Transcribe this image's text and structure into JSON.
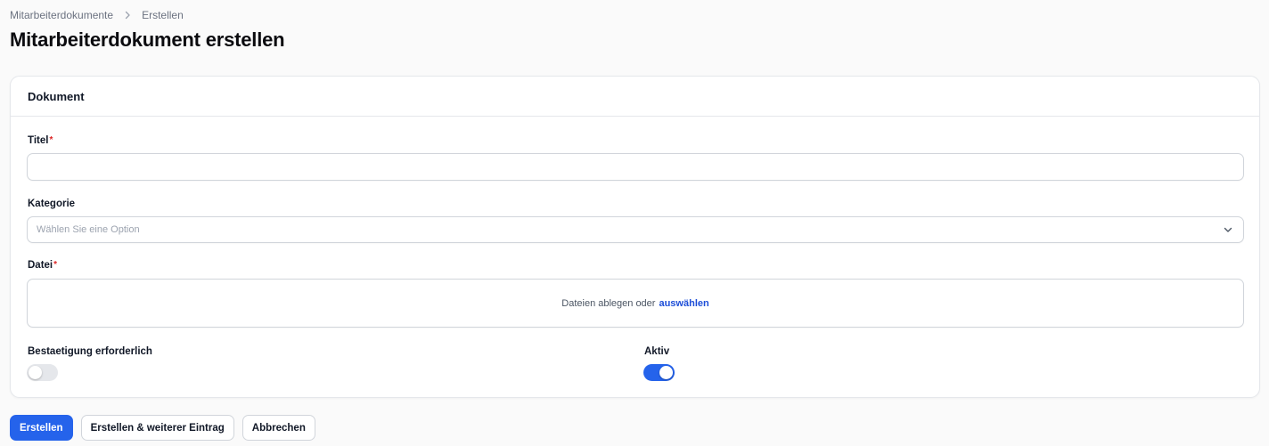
{
  "breadcrumb": {
    "items": [
      "Mitarbeiterdokumente",
      "Erstellen"
    ]
  },
  "page_title": "Mitarbeiterdokument erstellen",
  "section": {
    "title": "Dokument"
  },
  "fields": {
    "titel": {
      "label": "Titel",
      "required_mark": "*",
      "value": ""
    },
    "kategorie": {
      "label": "Kategorie",
      "placeholder": "Wählen Sie eine Option"
    },
    "datei": {
      "label": "Datei",
      "required_mark": "*",
      "drop_text": "Dateien ablegen oder",
      "drop_link": "auswählen"
    },
    "bestaetigung": {
      "label": "Bestaetigung erforderlich",
      "checked": false
    },
    "aktiv": {
      "label": "Aktiv",
      "checked": true
    }
  },
  "actions": {
    "create": "Erstellen",
    "create_another": "Erstellen & weiterer Eintrag",
    "cancel": "Abbrechen"
  },
  "colors": {
    "primary": "#2563eb",
    "link": "#1d4ed8",
    "required": "#dc2626",
    "toggle_off": "#e5e7eb"
  },
  "icons": {
    "breadcrumb_separator": "chevron-right-icon",
    "select_chevron": "chevron-down-icon"
  }
}
